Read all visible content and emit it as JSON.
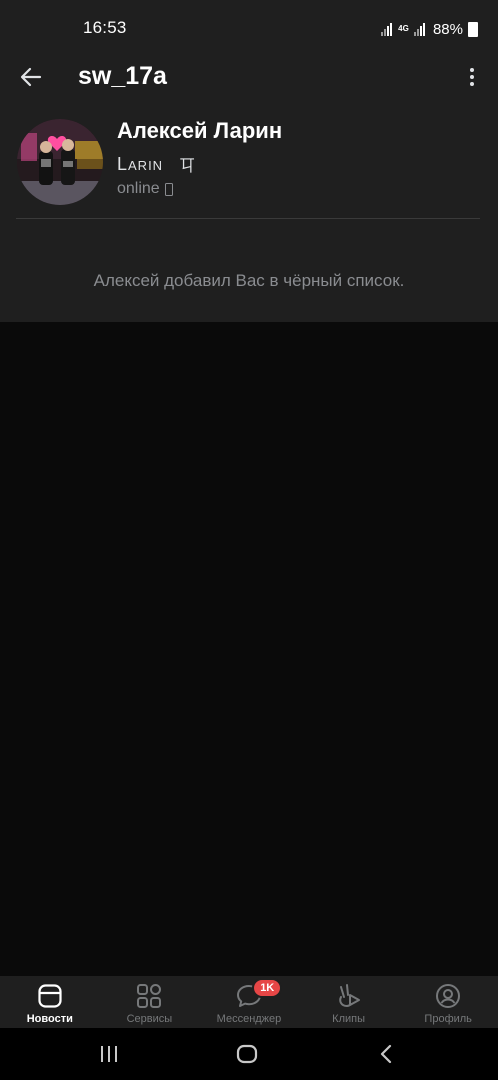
{
  "status_bar": {
    "time": "16:53",
    "network": "4G",
    "battery": "88%"
  },
  "header": {
    "title": "sw_17a",
    "back_icon": "arrow-left-icon",
    "menu_icon": "more-vertical-icon"
  },
  "profile": {
    "name": "Алексей Ларин",
    "status_text": "Larin",
    "status_glyph": "㔿",
    "online": "online",
    "online_device_icon": "phone-icon"
  },
  "message": {
    "blocked_text": "Алексей добавил Вас в чёрный список."
  },
  "tabs": [
    {
      "label": "Новости",
      "icon": "news-icon",
      "active": true
    },
    {
      "label": "Сервисы",
      "icon": "services-icon",
      "active": false
    },
    {
      "label": "Мессенджер",
      "icon": "messenger-icon",
      "active": false,
      "badge": "1K"
    },
    {
      "label": "Клипы",
      "icon": "clips-icon",
      "active": false
    },
    {
      "label": "Профиль",
      "icon": "profile-icon",
      "active": false
    }
  ],
  "colors": {
    "background": "#0a0a0a",
    "panel": "#1f1f1f",
    "text_primary": "#ffffff",
    "text_secondary": "#8a8c90",
    "badge": "#e64646"
  }
}
